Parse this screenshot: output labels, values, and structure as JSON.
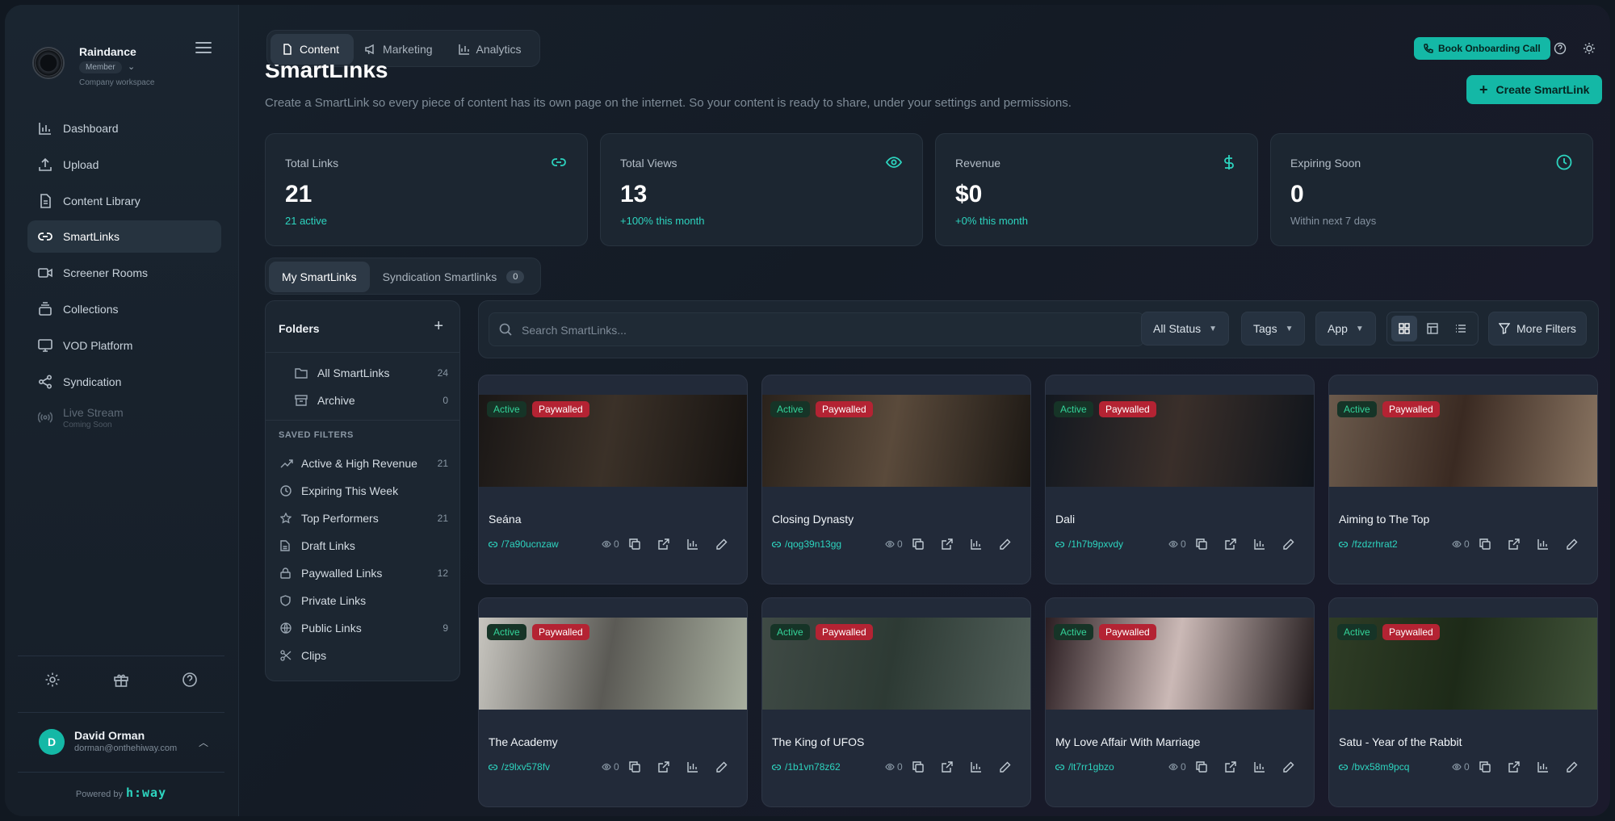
{
  "brand": {
    "name": "Raindance",
    "role": "Member",
    "subtitle": "Company workspace"
  },
  "nav": [
    {
      "label": "Dashboard",
      "icon": "bar-chart-icon"
    },
    {
      "label": "Upload",
      "icon": "upload-icon"
    },
    {
      "label": "Content Library",
      "icon": "file-icon"
    },
    {
      "label": "SmartLinks",
      "icon": "link-icon",
      "active": true
    },
    {
      "label": "Screener Rooms",
      "icon": "video-icon"
    },
    {
      "label": "Collections",
      "icon": "stack-icon"
    },
    {
      "label": "VOD Platform",
      "icon": "monitor-icon"
    },
    {
      "label": "Syndication",
      "icon": "share-icon"
    },
    {
      "label": "Live Stream",
      "icon": "broadcast-icon",
      "note": "Coming Soon",
      "disabled": true
    }
  ],
  "user": {
    "initial": "D",
    "name": "David Orman",
    "email": "dorman@onthehiway.com"
  },
  "footer": {
    "powered_by": "Powered by",
    "logo_text": "h:way"
  },
  "topbar": {
    "tabs": [
      {
        "label": "Content",
        "icon": "file-icon",
        "active": true
      },
      {
        "label": "Marketing",
        "icon": "megaphone-icon"
      },
      {
        "label": "Analytics",
        "icon": "bar-chart-icon"
      }
    ],
    "book_call": "Book Onboarding Call"
  },
  "page": {
    "title": "SmartLinks",
    "description": "Create a SmartLink so every piece of content has its own page on the internet. So your content is ready to share, under your settings and permissions.",
    "create_button": "Create SmartLink"
  },
  "stats": [
    {
      "label": "Total Links",
      "value": "21",
      "sub": "21 active",
      "icon": "link-icon",
      "accent": true
    },
    {
      "label": "Total Views",
      "value": "13",
      "sub": "+100% this month",
      "icon": "eye-icon",
      "accent": true
    },
    {
      "label": "Revenue",
      "value": "$0",
      "sub": "+0% this month",
      "icon": "dollar-icon",
      "accent": true
    },
    {
      "label": "Expiring Soon",
      "value": "0",
      "sub": "Within next 7 days",
      "icon": "clock-icon",
      "accent": false
    }
  ],
  "subtabs": [
    {
      "label": "My SmartLinks",
      "active": true
    },
    {
      "label": "Syndication Smartlinks",
      "count": "0"
    }
  ],
  "folders": {
    "title": "Folders",
    "items": [
      {
        "label": "All SmartLinks",
        "count": "24",
        "icon": "folder-icon"
      },
      {
        "label": "Archive",
        "count": "0",
        "icon": "archive-icon"
      }
    ],
    "saved_filters_title": "SAVED FILTERS",
    "saved_filters": [
      {
        "label": "Active & High Revenue",
        "count": "21",
        "icon": "trending-up-icon"
      },
      {
        "label": "Expiring This Week",
        "count": "",
        "icon": "clock-icon"
      },
      {
        "label": "Top Performers",
        "count": "21",
        "icon": "star-icon"
      },
      {
        "label": "Draft Links",
        "count": "",
        "icon": "file-icon"
      },
      {
        "label": "Paywalled Links",
        "count": "12",
        "icon": "lock-icon"
      },
      {
        "label": "Private Links",
        "count": "",
        "icon": "shield-icon"
      },
      {
        "label": "Public Links",
        "count": "9",
        "icon": "globe-icon"
      },
      {
        "label": "Clips",
        "count": "",
        "icon": "scissors-icon"
      }
    ]
  },
  "search": {
    "placeholder": "Search SmartLinks...",
    "status": "All Status",
    "tags": "Tags",
    "app": "App",
    "more_filters": "More Filters"
  },
  "badges": {
    "active": "Active",
    "paywalled": "Paywalled"
  },
  "cards": [
    {
      "title": "Seána",
      "slug": "/7a90ucnzaw",
      "views": "0",
      "colors": [
        "#1a1716",
        "#3b3128",
        "#151210"
      ]
    },
    {
      "title": "Closing Dynasty",
      "slug": "/qog39n13gg",
      "views": "0",
      "colors": [
        "#2a221b",
        "#5a4a3b",
        "#1b1713"
      ]
    },
    {
      "title": "Dali",
      "slug": "/1h7b9pxvdy",
      "views": "0",
      "colors": [
        "#131820",
        "#3a2f2a",
        "#0f141b"
      ]
    },
    {
      "title": "Aiming to The Top",
      "slug": "/fzdzrhrat2",
      "views": "0",
      "colors": [
        "#6b5a4c",
        "#3a2a22",
        "#8a7562"
      ]
    },
    {
      "title": "The Academy",
      "slug": "/z9lxv578fv",
      "views": "0",
      "colors": [
        "#c7c5bf",
        "#5b5a55",
        "#a9b0a0"
      ]
    },
    {
      "title": "The King of UFOS",
      "slug": "/1b1vn78z62",
      "views": "0",
      "colors": [
        "#3f4a45",
        "#2d3a34",
        "#52605a"
      ]
    },
    {
      "title": "My Love Affair With Marriage",
      "slug": "/lt7rr1gbzo",
      "views": "0",
      "colors": [
        "#2b1e22",
        "#cbb9b6",
        "#1d1618"
      ]
    },
    {
      "title": "Satu - Year of the Rabbit",
      "slug": "/bvx58m9pcq",
      "views": "0",
      "colors": [
        "#2f3d26",
        "#1d2a18",
        "#42543a"
      ]
    }
  ]
}
